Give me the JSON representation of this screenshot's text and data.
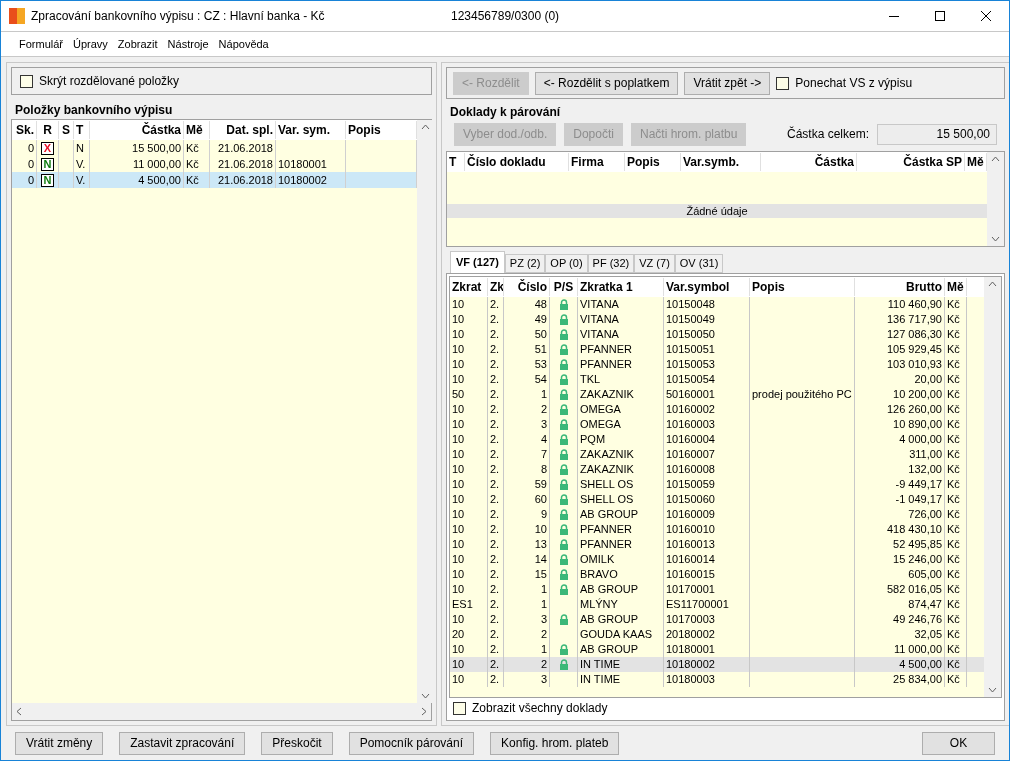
{
  "window": {
    "title": "Zpracování bankovního výpisu : CZ : Hlavní banka - Kč",
    "account": "123456789/0300 (0)"
  },
  "menu": [
    "Formulář",
    "Úpravy",
    "Zobrazit",
    "Nástroje",
    "Nápověda"
  ],
  "hide_split": {
    "label": "Skrýt rozdělované položky",
    "checked": false
  },
  "statement_items": {
    "title": "Položky bankovního výpisu",
    "columns": [
      "Sk.",
      "R",
      "S",
      "T",
      "Částka",
      "Mě",
      "Dat. spl.",
      "Var. sym.",
      "Popis"
    ],
    "rows": [
      {
        "sk": "0",
        "r": {
          "text": "X",
          "color": "#e81123"
        },
        "t": "N",
        "amount": "15 500,00",
        "currency": "Kč",
        "date": "21.06.2018",
        "selected": false
      },
      {
        "sk": "0",
        "r": {
          "text": "N",
          "color": "#107c10"
        },
        "t": "V.",
        "amount": "11 000,00",
        "currency": "Kč",
        "date": "21.06.2018",
        "var_sym": "10180001",
        "selected": false
      },
      {
        "sk": "0",
        "r": {
          "text": "N",
          "color": "#107c10"
        },
        "t": "V.",
        "amount": "4 500,00",
        "currency": "Kč",
        "date": "21.06.2018",
        "var_sym": "10180002",
        "selected": true
      }
    ]
  },
  "split_buttons": [
    {
      "label": "<- Rozdělit",
      "disabled": true
    },
    {
      "label": "<- Rozdělit s poplatkem",
      "disabled": false
    },
    {
      "label": "Vrátit zpět ->",
      "disabled": false
    }
  ],
  "keep_vs": {
    "label": "Ponechat VS z výpisu",
    "checked": false
  },
  "documents": {
    "title": "Doklady k párování",
    "buttons": [
      {
        "label": "Vyber dod./odb.",
        "disabled": true
      },
      {
        "label": "Dopočti",
        "disabled": true
      },
      {
        "label": "Načti hrom. platbu",
        "disabled": true
      }
    ],
    "total_label": "Částka celkem:",
    "total_value": "15 500,00",
    "columns": [
      "T",
      "Číslo dokladu",
      "Firma",
      "Popis",
      "Var.symb.",
      "Částka",
      "Částka SP",
      "Mě"
    ],
    "empty": "Žádné údaje"
  },
  "tabs": [
    {
      "label": "VF (127)",
      "selected": true
    },
    {
      "label": "PZ (2)",
      "selected": false
    },
    {
      "label": "OP (0)",
      "selected": false
    },
    {
      "label": "PF (32)",
      "selected": false
    },
    {
      "label": "VZ (7)",
      "selected": false
    },
    {
      "label": "OV (31)",
      "selected": false
    }
  ],
  "invoices": {
    "columns": [
      "Zkrat",
      "Zk",
      "Číslo",
      "P/S",
      "Zkratka 1",
      "Var.symbol",
      "Popis",
      "Brutto",
      "Mě"
    ],
    "rows": [
      {
        "zkrat": "10",
        "zk": "2.",
        "cislo": "48",
        "zkratka": "VITANA",
        "var_symbol": "10150048",
        "brutto": "110 460,90",
        "currency": "Kč",
        "locked": true,
        "selected": false
      },
      {
        "zkrat": "10",
        "zk": "2.",
        "cislo": "49",
        "zkratka": "VITANA",
        "var_symbol": "10150049",
        "brutto": "136 717,90",
        "currency": "Kč",
        "locked": true,
        "selected": false
      },
      {
        "zkrat": "10",
        "zk": "2.",
        "cislo": "50",
        "zkratka": "VITANA",
        "var_symbol": "10150050",
        "brutto": "127 086,30",
        "currency": "Kč",
        "locked": true,
        "selected": false
      },
      {
        "zkrat": "10",
        "zk": "2.",
        "cislo": "51",
        "zkratka": "PFANNER",
        "var_symbol": "10150051",
        "brutto": "105 929,45",
        "currency": "Kč",
        "locked": true,
        "selected": false
      },
      {
        "zkrat": "10",
        "zk": "2.",
        "cislo": "53",
        "zkratka": "PFANNER",
        "var_symbol": "10150053",
        "brutto": "103 010,93",
        "currency": "Kč",
        "locked": true,
        "selected": false
      },
      {
        "zkrat": "10",
        "zk": "2.",
        "cislo": "54",
        "zkratka": "TKL",
        "var_symbol": "10150054",
        "brutto": "20,00",
        "currency": "Kč",
        "locked": true,
        "selected": false
      },
      {
        "zkrat": "50",
        "zk": "2.",
        "cislo": "1",
        "zkratka": "ZAKAZNIK",
        "var_symbol": "50160001",
        "popis": "prodej použitého PC",
        "brutto": "10 200,00",
        "currency": "Kč",
        "locked": true,
        "selected": false
      },
      {
        "zkrat": "10",
        "zk": "2.",
        "cislo": "2",
        "zkratka": "OMEGA",
        "var_symbol": "10160002",
        "brutto": "126 260,00",
        "currency": "Kč",
        "locked": true,
        "selected": false
      },
      {
        "zkrat": "10",
        "zk": "2.",
        "cislo": "3",
        "zkratka": "OMEGA",
        "var_symbol": "10160003",
        "brutto": "10 890,00",
        "currency": "Kč",
        "locked": true,
        "selected": false
      },
      {
        "zkrat": "10",
        "zk": "2.",
        "cislo": "4",
        "zkratka": "PQM",
        "var_symbol": "10160004",
        "brutto": "4 000,00",
        "currency": "Kč",
        "locked": true,
        "selected": false
      },
      {
        "zkrat": "10",
        "zk": "2.",
        "cislo": "7",
        "zkratka": "ZAKAZNIK",
        "var_symbol": "10160007",
        "brutto": "311,00",
        "currency": "Kč",
        "locked": true,
        "selected": false
      },
      {
        "zkrat": "10",
        "zk": "2.",
        "cislo": "8",
        "zkratka": "ZAKAZNIK",
        "var_symbol": "10160008",
        "brutto": "132,00",
        "currency": "Kč",
        "locked": true,
        "selected": false
      },
      {
        "zkrat": "10",
        "zk": "2.",
        "cislo": "59",
        "zkratka": "SHELL OS",
        "var_symbol": "10150059",
        "brutto": "-9 449,17",
        "currency": "Kč",
        "locked": true,
        "selected": false
      },
      {
        "zkrat": "10",
        "zk": "2.",
        "cislo": "60",
        "zkratka": "SHELL OS",
        "var_symbol": "10150060",
        "brutto": "-1 049,17",
        "currency": "Kč",
        "locked": true,
        "selected": false
      },
      {
        "zkrat": "10",
        "zk": "2.",
        "cislo": "9",
        "zkratka": "AB GROUP",
        "var_symbol": "10160009",
        "brutto": "726,00",
        "currency": "Kč",
        "locked": true,
        "selected": false
      },
      {
        "zkrat": "10",
        "zk": "2.",
        "cislo": "10",
        "zkratka": "PFANNER",
        "var_symbol": "10160010",
        "brutto": "418 430,10",
        "currency": "Kč",
        "locked": true,
        "selected": false
      },
      {
        "zkrat": "10",
        "zk": "2.",
        "cislo": "13",
        "zkratka": "PFANNER",
        "var_symbol": "10160013",
        "brutto": "52 495,85",
        "currency": "Kč",
        "locked": true,
        "selected": false
      },
      {
        "zkrat": "10",
        "zk": "2.",
        "cislo": "14",
        "zkratka": "OMILK",
        "var_symbol": "10160014",
        "brutto": "15 246,00",
        "currency": "Kč",
        "locked": true,
        "selected": false
      },
      {
        "zkrat": "10",
        "zk": "2.",
        "cislo": "15",
        "zkratka": "BRAVO",
        "var_symbol": "10160015",
        "brutto": "605,00",
        "currency": "Kč",
        "locked": true,
        "selected": false
      },
      {
        "zkrat": "10",
        "zk": "2.",
        "cislo": "1",
        "zkratka": "AB GROUP",
        "var_symbol": "10170001",
        "brutto": "582 016,05",
        "currency": "Kč",
        "locked": true,
        "selected": false
      },
      {
        "zkrat": "ES1",
        "zk": "2.",
        "cislo": "1",
        "zkratka": "MLÝNY",
        "var_symbol": "ES11700001",
        "brutto": "874,47",
        "currency": "Kč",
        "locked": false,
        "selected": false
      },
      {
        "zkrat": "10",
        "zk": "2.",
        "cislo": "3",
        "zkratka": "AB GROUP",
        "var_symbol": "10170003",
        "brutto": "49 246,76",
        "currency": "Kč",
        "locked": true,
        "selected": false
      },
      {
        "zkrat": "20",
        "zk": "2.",
        "cislo": "2",
        "zkratka": "GOUDA KAAS",
        "var_symbol": "20180002",
        "brutto": "32,05",
        "currency": "Kč",
        "locked": false,
        "selected": false
      },
      {
        "zkrat": "10",
        "zk": "2.",
        "cislo": "1",
        "zkratka": "AB GROUP",
        "var_symbol": "10180001",
        "brutto": "11 000,00",
        "currency": "Kč",
        "locked": true,
        "selected": false
      },
      {
        "zkrat": "10",
        "zk": "2.",
        "cislo": "2",
        "zkratka": "IN TIME",
        "var_symbol": "10180002",
        "brutto": "4 500,00",
        "currency": "Kč",
        "locked": true,
        "selected": true
      },
      {
        "zkrat": "10",
        "zk": "2.",
        "cislo": "3",
        "zkratka": "IN TIME",
        "var_symbol": "10180003",
        "brutto": "25 834,00",
        "currency": "Kč",
        "locked": false,
        "selected": false
      }
    ]
  },
  "show_all": {
    "label": "Zobrazit všechny doklady",
    "checked": false
  },
  "footer_buttons": [
    "Vrátit změny",
    "Zastavit zpracování",
    "Přeskočit",
    "Pomocník párování",
    "Konfig. hrom. plateb"
  ],
  "ok": "OK"
}
